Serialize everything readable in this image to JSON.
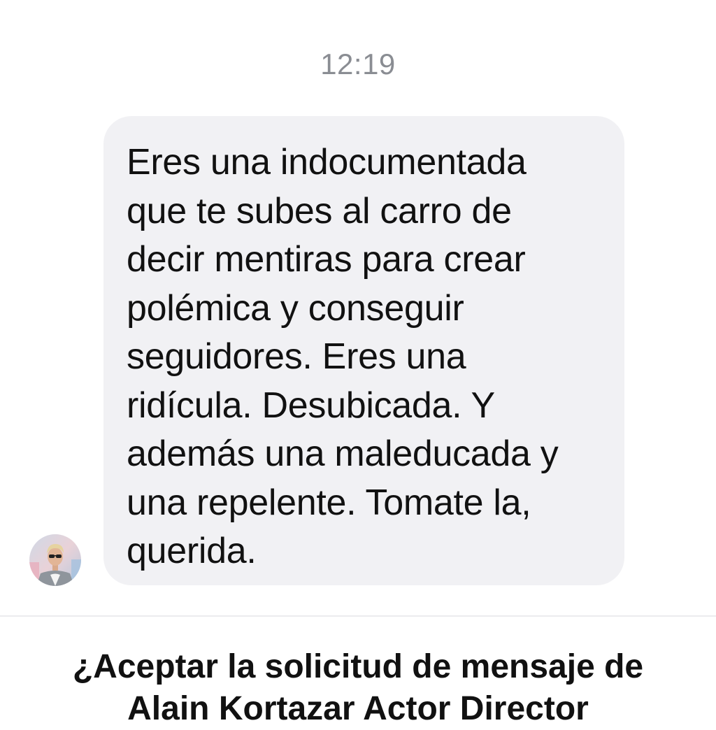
{
  "thread": {
    "timestamp": "12:19"
  },
  "message": {
    "avatar_icon": "user-avatar-icon",
    "text": "Eres una indocumentada\nque te subes al carro de\ndecir mentiras para crear\npolémica y conseguir\nseguidores. Eres una\nridícula. Desubicada. Y\nademás una maleducada y\nuna repelente. Tomate la,\nquerida.",
    "bubble_color": "#f1f1f4"
  },
  "request": {
    "title": "¿Aceptar la solicitud de mensaje de\nAlain Kortazar Actor Director"
  }
}
